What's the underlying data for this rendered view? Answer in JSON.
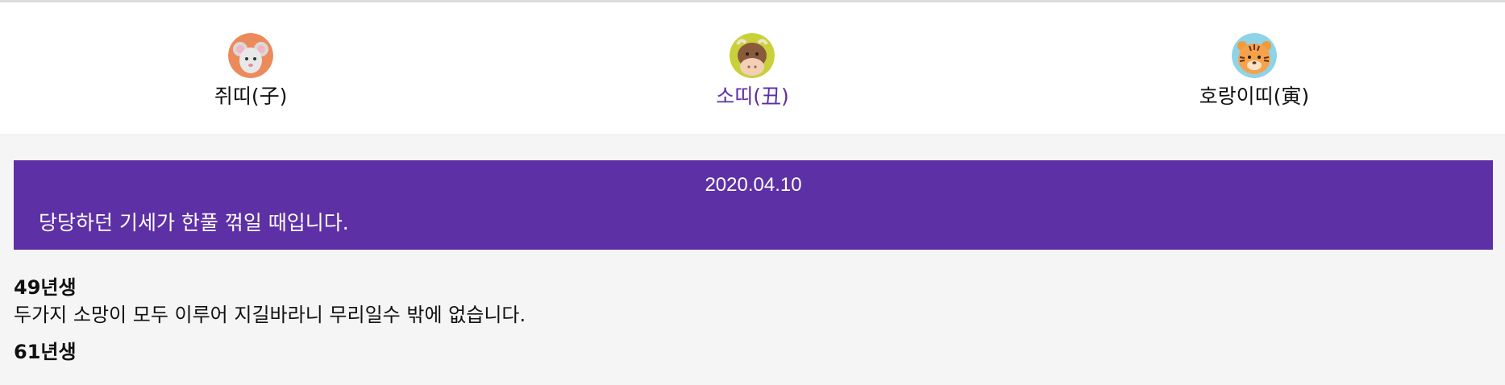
{
  "tabs": [
    {
      "label": "쥐띠(子)",
      "icon": "rat-icon",
      "bg": "#ec8a5c",
      "active": false
    },
    {
      "label": "소띠(丑)",
      "icon": "ox-icon",
      "bg": "#c8d13a",
      "active": true
    },
    {
      "label": "호랑이띠(寅)",
      "icon": "tiger-icon",
      "bg": "#8fd3e8",
      "active": false
    }
  ],
  "fortune": {
    "date": "2020.04.10",
    "message": "당당하던 기세가 한풀 꺾일 때입니다."
  },
  "entries": [
    {
      "year": "49년생",
      "text": "두가지 소망이 모두 이루어 지길바라니 무리일수 밖에 없습니다."
    },
    {
      "year": "61년생",
      "text": ""
    }
  ],
  "colors": {
    "accent": "#5e30a5",
    "active_tab_text": "#5e2ea6",
    "page_bg": "#f5f5f5"
  }
}
